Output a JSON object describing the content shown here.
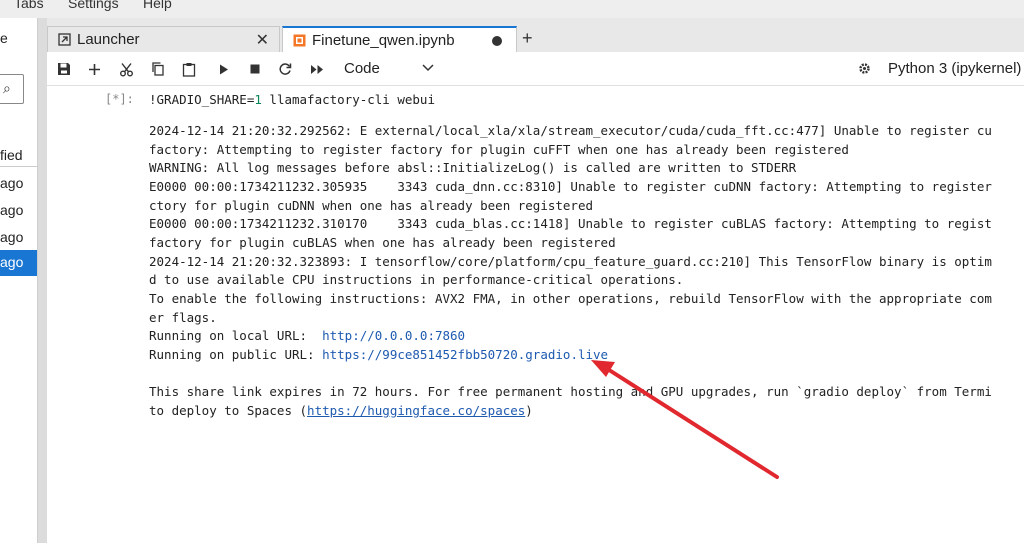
{
  "menubar": {
    "items": [
      "Tabs",
      "Settings",
      "Help"
    ]
  },
  "left_panel": {
    "partial_header": "e",
    "modified_header": "fied",
    "rows": [
      "ago",
      "ago",
      "ago",
      "ago"
    ]
  },
  "tabs": [
    {
      "label": "Launcher",
      "icon": "launcher-icon",
      "close": "✕"
    },
    {
      "label": "Finetune_qwen.ipynb",
      "icon": "notebook-icon",
      "modified": true
    }
  ],
  "new_tab_label": "+",
  "toolbar": {
    "cell_type": "Code",
    "kernel": "Python 3 (ipykernel)"
  },
  "cell": {
    "prompt": "[*]:",
    "code_prefix": "!GRADIO_SHARE=",
    "code_num": "1",
    "code_suffix": " llamafactory-cli webui"
  },
  "output": {
    "lines": [
      "2024-12-14 21:20:32.292562: E external/local_xla/xla/stream_executor/cuda/cuda_fft.cc:477] Unable to register cu",
      "factory: Attempting to register factory for plugin cuFFT when one has already been registered",
      "WARNING: All log messages before absl::InitializeLog() is called are written to STDERR",
      "E0000 00:00:1734211232.305935    3343 cuda_dnn.cc:8310] Unable to register cuDNN factory: Attempting to register",
      "ctory for plugin cuDNN when one has already been registered",
      "E0000 00:00:1734211232.310170    3343 cuda_blas.cc:1418] Unable to register cuBLAS factory: Attempting to regist",
      "factory for plugin cuBLAS when one has already been registered",
      "2024-12-14 21:20:32.323893: I tensorflow/core/platform/cpu_feature_guard.cc:210] This TensorFlow binary is optim",
      "d to use available CPU instructions in performance-critical operations.",
      "To enable the following instructions: AVX2 FMA, in other operations, rebuild TensorFlow with the appropriate com",
      "er flags."
    ],
    "local_label": "Running on local URL:  ",
    "local_url": "http://0.0.0.0:7860",
    "public_label": "Running on public URL: ",
    "public_url": "https://99ce851452fbb50720.gradio.live",
    "share_line1": "This share link expires in 72 hours. For free permanent hosting and GPU upgrades, run `gradio deploy` from Termi",
    "share_line2_prefix": "to deploy to Spaces (",
    "spaces_url": "https://huggingface.co/spaces",
    "share_line2_suffix": ")"
  },
  "colors": {
    "accent": "#1976d2",
    "link": "#1e5ab0",
    "annotation_arrow": "#e0282e",
    "notebook_icon": "#f37726"
  }
}
